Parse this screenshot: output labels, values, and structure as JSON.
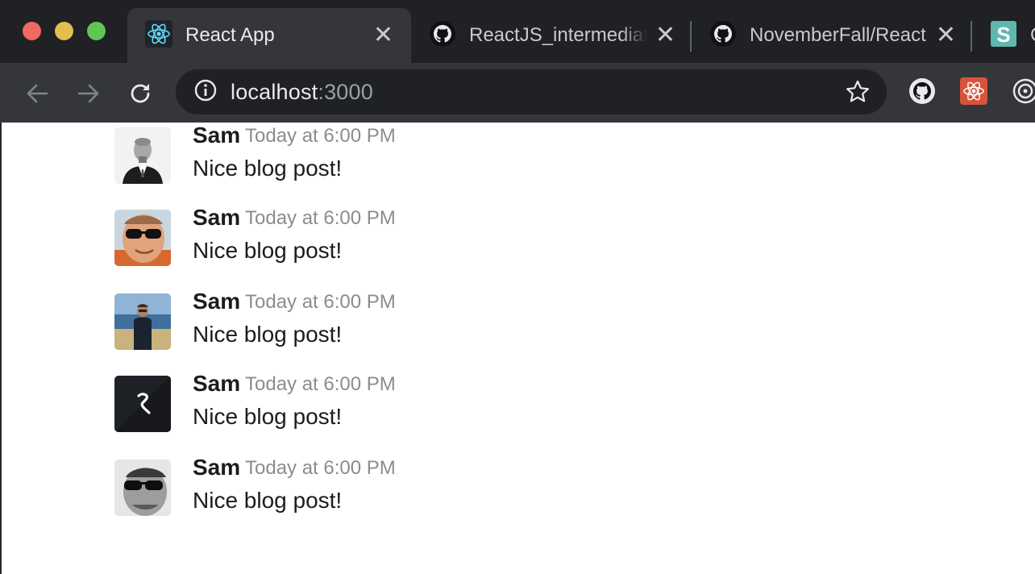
{
  "browser": {
    "tabs": [
      {
        "title": "React App",
        "icon": "react-icon",
        "active": true
      },
      {
        "title": "ReactJS_intermediat",
        "icon": "github-icon",
        "active": false
      },
      {
        "title": "NovemberFall/React",
        "icon": "github-icon",
        "active": false
      },
      {
        "title": "C",
        "icon": "s-app-icon",
        "active": false
      }
    ],
    "close_glyph": "✕",
    "address": {
      "host": "localhost",
      "port": ":3000"
    },
    "extensions": [
      "github-icon",
      "react-devtools-icon",
      "target-icon"
    ]
  },
  "comments": [
    {
      "author": "Sam",
      "date": "Today at 6:00 PM",
      "text": "Nice blog post!",
      "avatar": "avatar-man-suit"
    },
    {
      "author": "Sam",
      "date": "Today at 6:00 PM",
      "text": "Nice blog post!",
      "avatar": "avatar-man-sunglasses"
    },
    {
      "author": "Sam",
      "date": "Today at 6:00 PM",
      "text": "Nice blog post!",
      "avatar": "avatar-man-seaside"
    },
    {
      "author": "Sam",
      "date": "Today at 6:00 PM",
      "text": "Nice blog post!",
      "avatar": "avatar-s-logo"
    },
    {
      "author": "Sam",
      "date": "Today at 6:00 PM",
      "text": "Nice blog post!",
      "avatar": "avatar-man-sunglasses-bw"
    }
  ],
  "colors": {
    "tabstrip": "#202124",
    "toolbar": "#35363a",
    "author": "#1b1c1d",
    "meta": "#8c8c8c"
  }
}
